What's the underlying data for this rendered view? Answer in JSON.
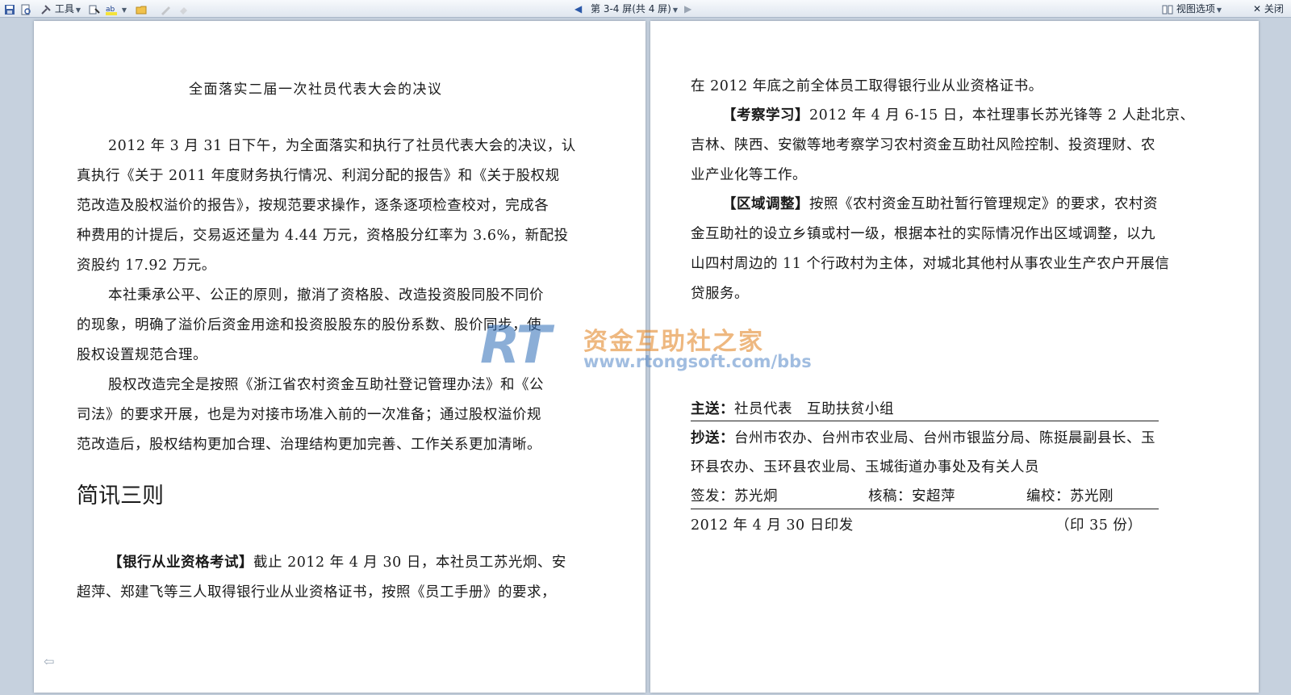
{
  "toolbar": {
    "tools_label": "工具",
    "pagination_label": "第 3-4 屏(共 4 屏)",
    "view_options_label": "视图选项",
    "close_label": "关闭"
  },
  "left_page": {
    "title": "全面落实二届一次社员代表大会的决议",
    "lines": [
      "2012 年 3 月 31 日下午，为全面落实和执行了社员代表大会的决议，认",
      "真执行《关于 2011 年度财务执行情况、利润分配的报告》和《关于股权规",
      "范改造及股权溢价的报告》，按规范要求操作，逐条逐项检查校对，完成各",
      "种费用的计提后，交易返还量为 4.44 万元，资格股分红率为 3.6%，新配投",
      "资股约 17.92 万元。",
      "本社秉承公平、公正的原则，撤消了资格股、改造投资股同股不同价",
      "的现象，明确了溢价后资金用途和投资股股东的股份系数、股价同步，使",
      "股权设置规范合理。",
      "股权改造完全是按照《浙江省农村资金互助社登记管理办法》和《公",
      "司法》的要求开展，也是为对接市场准入前的一次准备；通过股权溢价规",
      "范改造后，股权结构更加合理、治理结构更加完善、工作关系更加清晰。"
    ],
    "heading": "简讯三则",
    "news1_tag": "【银行从业资格考试】",
    "news1_line1": "截止 2012 年 4 月 30 日，本社员工苏光炯、安",
    "news1_line2": "超萍、郑建飞等三人取得银行业从业资格证书，按照《员工手册》的要求，"
  },
  "right_page": {
    "line_cont": "在 2012 年底之前全体员工取得银行业从业资格证书。",
    "news2_tag": "【考察学习】",
    "news2_line1": "2012 年 4 月 6-15 日，本社理事长苏光锋等 2 人赴北京、",
    "news2_line2": "吉林、陕西、安徽等地考察学习农村资金互助社风险控制、投资理财、农",
    "news2_line3": "业产业化等工作。",
    "news3_tag": "【区域调整】",
    "news3_line1": "按照《农村资金互助社暂行管理规定》的要求，农村资",
    "news3_line2": "金互助社的设立乡镇或村一级，根据本社的实际情况作出区域调整，以九",
    "news3_line3": "山四村周边的 11 个行政村为主体，对城北其他村从事农业生产农户开展信",
    "news3_line4": "贷服务。",
    "zhusong_label": "主送：",
    "zhusong_value": "社员代表　互助扶贫小组",
    "chaosong_label": "抄送：",
    "chaosong_line1": "台州市农办、台州市农业局、台州市银监分局、陈挺晨副县长、玉",
    "chaosong_line2": "环县农办、玉环县农业局、玉城街道办事处及有关人员",
    "qianfa": "签发：苏光炯",
    "hegao": "核稿：安超萍",
    "bianjiao": "编校：苏光刚",
    "print_date": "2012 年 4 月 30 日印发",
    "copies": "（印 35 份）"
  },
  "watermark": {
    "logo_text": "RT",
    "name": "资金互助社之家",
    "url": "www.rtongsoft.com/bbs"
  },
  "colors": {
    "background": "#c6d1de",
    "watermark_blue": "#2e6db8",
    "watermark_orange": "#e38a2d"
  }
}
